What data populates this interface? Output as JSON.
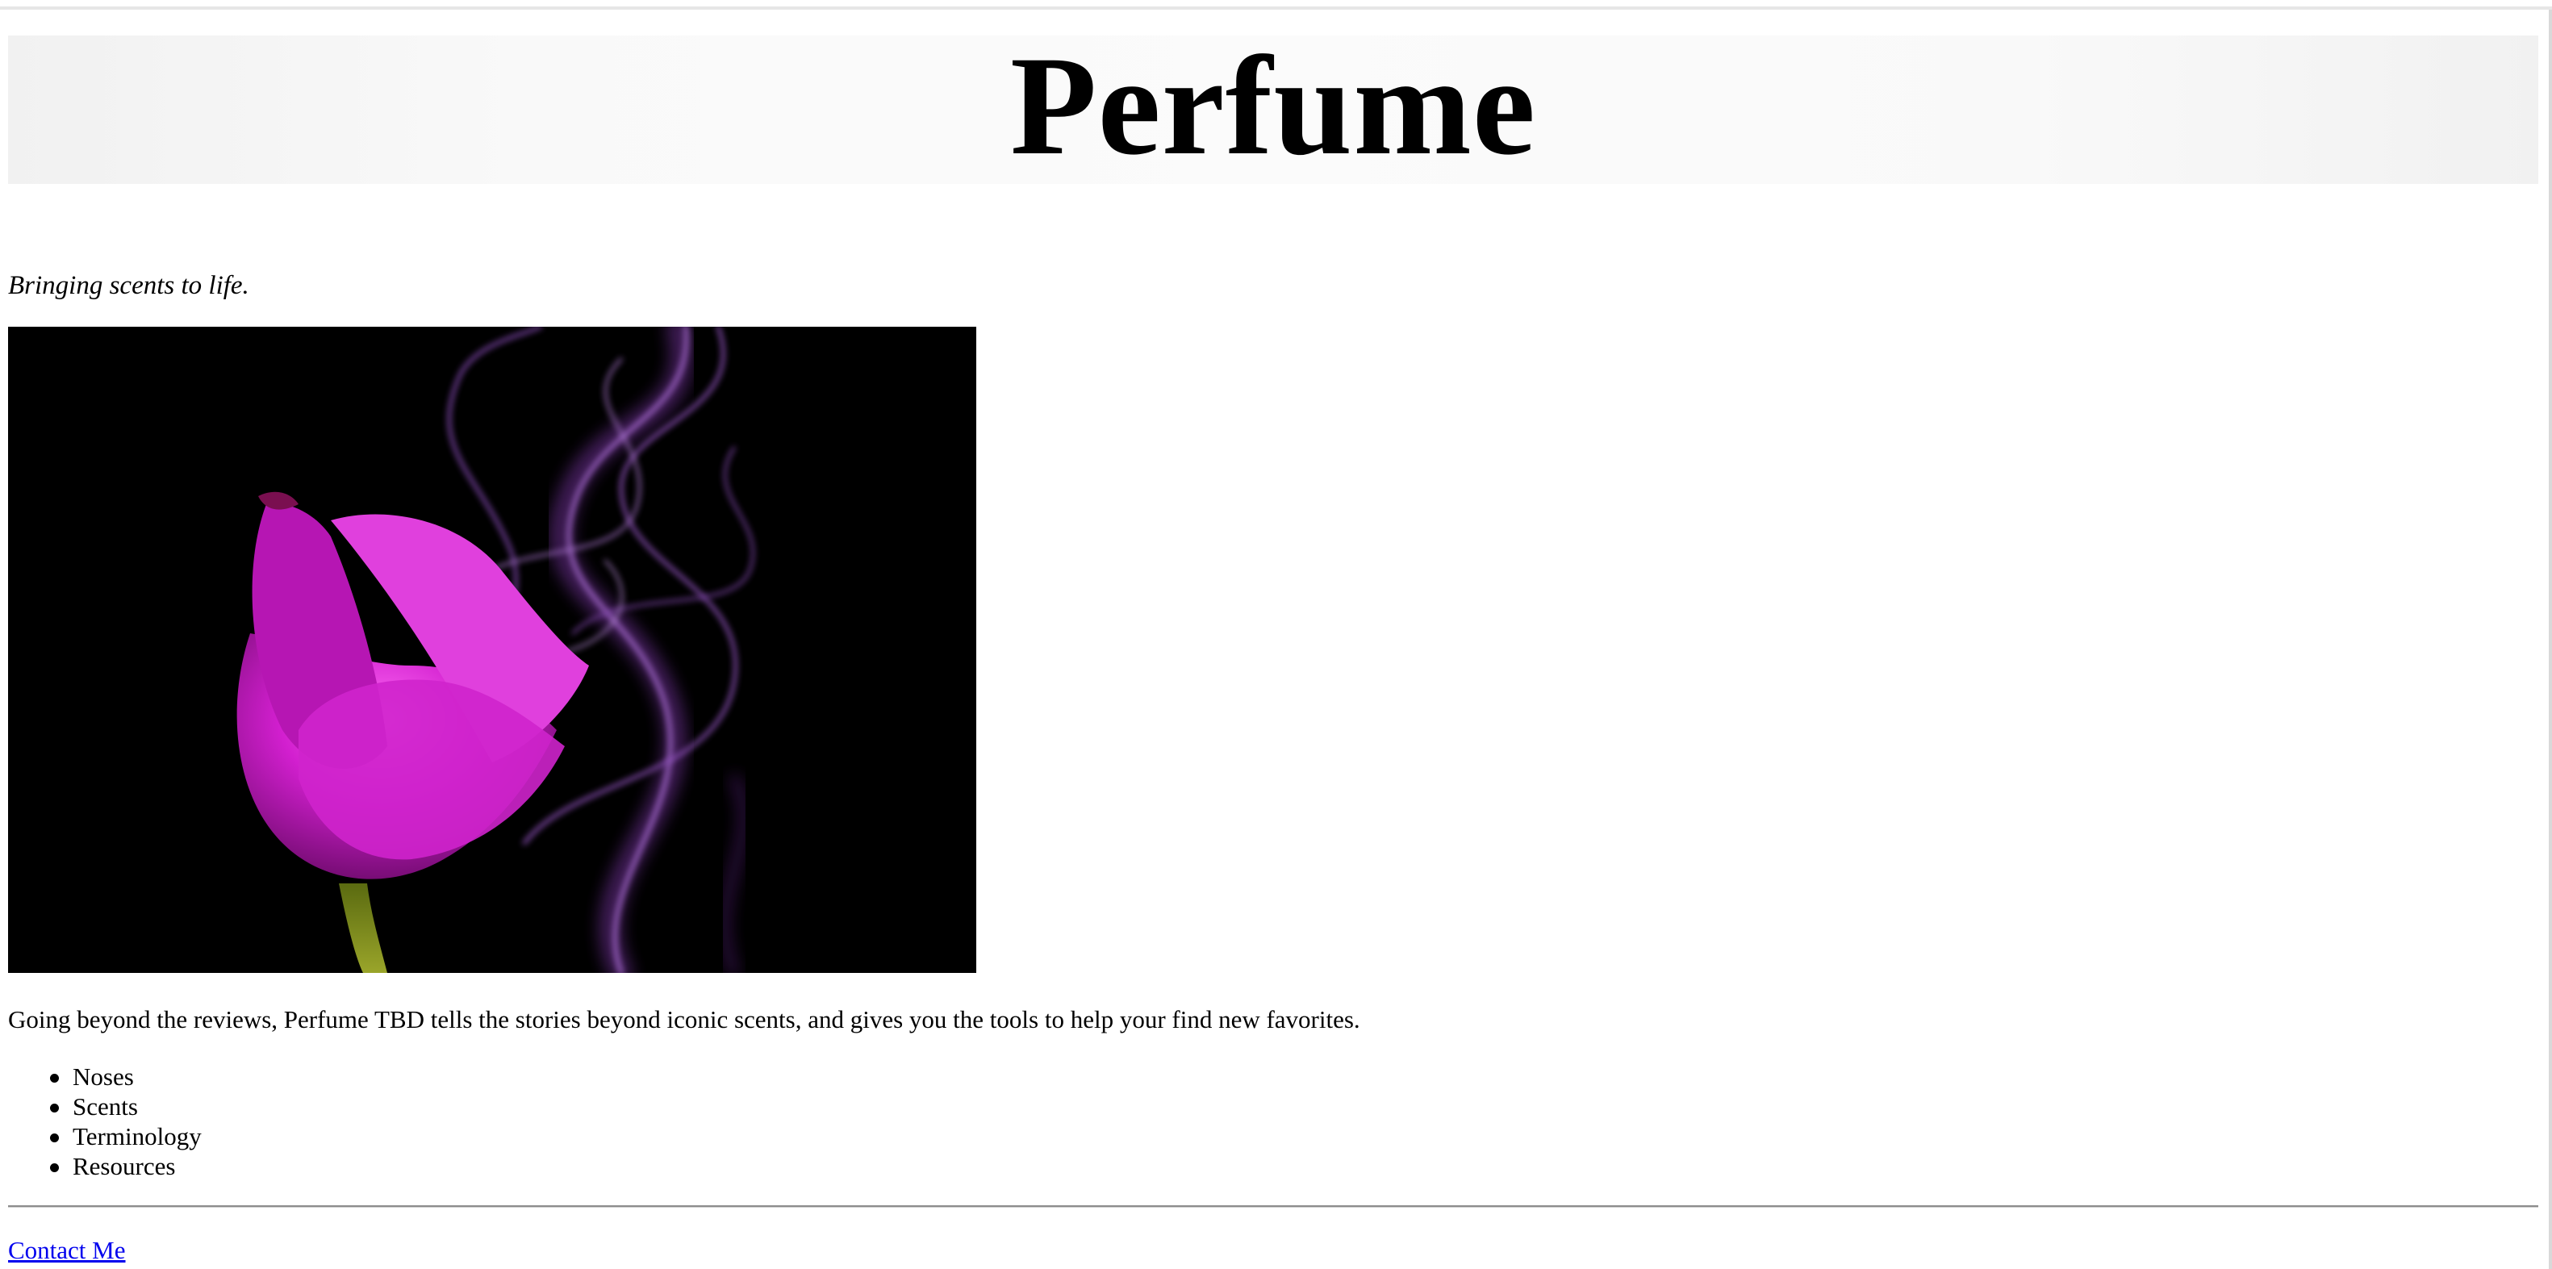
{
  "header": {
    "title": "Perfume"
  },
  "tagline": "Bringing scents to life.",
  "hero_image": {
    "description_icon": "purple-tulip-with-smoke-photo"
  },
  "description": "Going beyond the reviews, Perfume TBD tells the stories beyond iconic scents, and gives you the tools to help your find new favorites.",
  "nav": {
    "items": [
      {
        "label": "Noses"
      },
      {
        "label": "Scents"
      },
      {
        "label": "Terminology"
      },
      {
        "label": "Resources"
      }
    ]
  },
  "footer": {
    "contact_label": "Contact Me"
  },
  "colors": {
    "link": "#0000ee",
    "flower": "#c81fc4",
    "smoke": "#a44ad8"
  }
}
